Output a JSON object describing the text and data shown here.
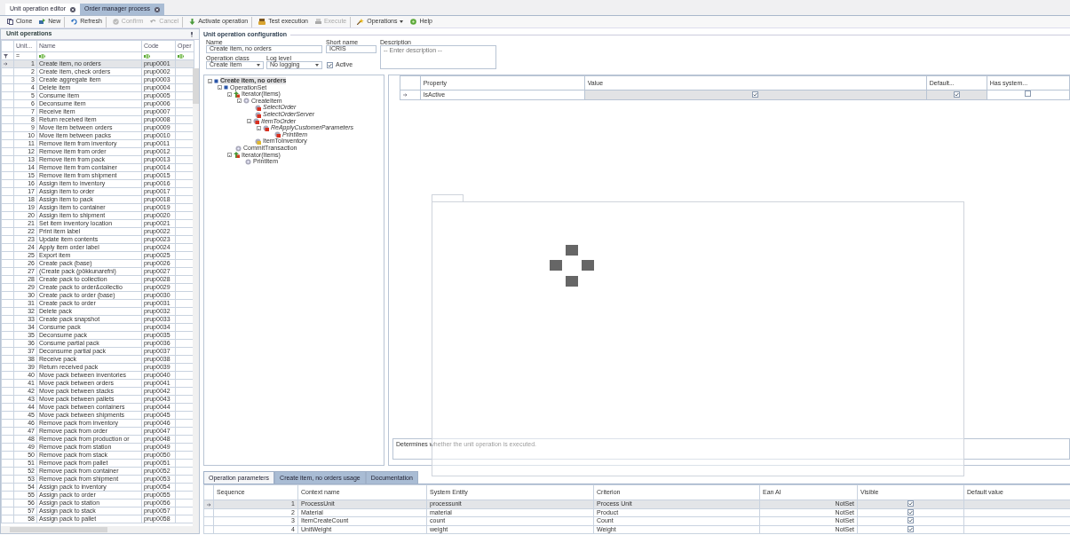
{
  "document_tabs": [
    {
      "label": "Unit operation editor",
      "selected": true
    },
    {
      "label": "Order manager process",
      "selected": false
    }
  ],
  "toolbar": [
    {
      "label": "Clone",
      "disabled": false,
      "group_end": false
    },
    {
      "label": "New",
      "disabled": false,
      "group_end": true
    },
    {
      "label": "Refresh",
      "disabled": false,
      "group_end": true
    },
    {
      "label": "Confirm",
      "disabled": true,
      "group_end": false
    },
    {
      "label": "Cancel",
      "disabled": true,
      "group_end": true
    },
    {
      "label": "Activate operation",
      "disabled": false,
      "group_end": true
    },
    {
      "label": "Test execution",
      "disabled": false,
      "group_end": false
    },
    {
      "label": "Execute",
      "disabled": true,
      "group_end": true
    },
    {
      "label": "Operations",
      "disabled": false,
      "group_end": false,
      "dropdown": true
    },
    {
      "label": "Help",
      "disabled": false,
      "group_end": false
    }
  ],
  "left_panel": {
    "title": "Unit operations",
    "columns": [
      "Unit...",
      "Name",
      "Code",
      "Oper"
    ],
    "filter": "=",
    "rows": [
      {
        "number": "1",
        "name": "Create item, no orders",
        "code": "prup0001",
        "selected": true
      },
      {
        "number": "2",
        "name": "Create item, check orders",
        "code": "prup0002",
        "selected": false
      },
      {
        "number": "3",
        "name": "Create aggregate item",
        "code": "prup0003",
        "selected": false
      },
      {
        "number": "4",
        "name": "Delete item",
        "code": "prup0004",
        "selected": false
      },
      {
        "number": "5",
        "name": "Consume item",
        "code": "prup0005",
        "selected": false
      },
      {
        "number": "6",
        "name": "Deconsume item",
        "code": "prup0006",
        "selected": false
      },
      {
        "number": "7",
        "name": "Receive item",
        "code": "prup0007",
        "selected": false
      },
      {
        "number": "8",
        "name": "Return received item",
        "code": "prup0008",
        "selected": false
      },
      {
        "number": "9",
        "name": "Move item between orders",
        "code": "prup0009",
        "selected": false
      },
      {
        "number": "10",
        "name": "Move item between packs",
        "code": "prup0010",
        "selected": false
      },
      {
        "number": "11",
        "name": "Remove item from inventory",
        "code": "prup0011",
        "selected": false
      },
      {
        "number": "12",
        "name": "Remove item from order",
        "code": "prup0012",
        "selected": false
      },
      {
        "number": "13",
        "name": "Remove item from pack",
        "code": "prup0013",
        "selected": false
      },
      {
        "number": "14",
        "name": "Remove item from container",
        "code": "prup0014",
        "selected": false
      },
      {
        "number": "15",
        "name": "Remove item from shipment",
        "code": "prup0015",
        "selected": false
      },
      {
        "number": "16",
        "name": "Assign item to inventory",
        "code": "prup0016",
        "selected": false
      },
      {
        "number": "17",
        "name": "Assign item to order",
        "code": "prup0017",
        "selected": false
      },
      {
        "number": "18",
        "name": "Assign item to pack",
        "code": "prup0018",
        "selected": false
      },
      {
        "number": "19",
        "name": "Assign item to container",
        "code": "prup0019",
        "selected": false
      },
      {
        "number": "20",
        "name": "Assign item to shipment",
        "code": "prup0020",
        "selected": false
      },
      {
        "number": "21",
        "name": "Set item inventory location",
        "code": "prup0021",
        "selected": false
      },
      {
        "number": "22",
        "name": "Print item label",
        "code": "prup0022",
        "selected": false
      },
      {
        "number": "23",
        "name": "Update item contents",
        "code": "prup0023",
        "selected": false
      },
      {
        "number": "24",
        "name": "Apply item order label",
        "code": "prup0024",
        "selected": false
      },
      {
        "number": "25",
        "name": "Export item",
        "code": "prup0025",
        "selected": false
      },
      {
        "number": "26",
        "name": "Create pack (base)",
        "code": "prup0026",
        "selected": false
      },
      {
        "number": "27",
        "name": "(Create pack (pökkunarefni)",
        "code": "prup0027",
        "selected": false
      },
      {
        "number": "28",
        "name": "Create pack to collection",
        "code": "prup0028",
        "selected": false
      },
      {
        "number": "29",
        "name": "Create pack to order&collectio",
        "code": "prup0029",
        "selected": false
      },
      {
        "number": "30",
        "name": "Create pack to order (base)",
        "code": "prup0030",
        "selected": false
      },
      {
        "number": "31",
        "name": "Create pack to order",
        "code": "prup0031",
        "selected": false
      },
      {
        "number": "32",
        "name": "Delete pack",
        "code": "prup0032",
        "selected": false
      },
      {
        "number": "33",
        "name": "Create pack snapshot",
        "code": "prup0033",
        "selected": false
      },
      {
        "number": "34",
        "name": "Consume pack",
        "code": "prup0034",
        "selected": false
      },
      {
        "number": "35",
        "name": "Deconsume pack",
        "code": "prup0035",
        "selected": false
      },
      {
        "number": "36",
        "name": "Consume partial pack",
        "code": "prup0036",
        "selected": false
      },
      {
        "number": "37",
        "name": "Deconsume partial pack",
        "code": "prup0037",
        "selected": false
      },
      {
        "number": "38",
        "name": "Receive pack",
        "code": "prup0038",
        "selected": false
      },
      {
        "number": "39",
        "name": "Return received pack",
        "code": "prup0039",
        "selected": false
      },
      {
        "number": "40",
        "name": "Move pack between inventories",
        "code": "prup0040",
        "selected": false
      },
      {
        "number": "41",
        "name": "Move pack between orders",
        "code": "prup0041",
        "selected": false
      },
      {
        "number": "42",
        "name": "Move pack between stacks",
        "code": "prup0042",
        "selected": false
      },
      {
        "number": "43",
        "name": "Move pack between pallets",
        "code": "prup0043",
        "selected": false
      },
      {
        "number": "44",
        "name": "Move pack between containers",
        "code": "prup0044",
        "selected": false
      },
      {
        "number": "45",
        "name": "Move pack between shipments",
        "code": "prup0045",
        "selected": false
      },
      {
        "number": "46",
        "name": "Remove pack from inventory",
        "code": "prup0046",
        "selected": false
      },
      {
        "number": "47",
        "name": "Remove pack from order",
        "code": "prup0047",
        "selected": false
      },
      {
        "number": "48",
        "name": "Remove pack from production or",
        "code": "prup0048",
        "selected": false
      },
      {
        "number": "49",
        "name": "Remove pack from station",
        "code": "prup0049",
        "selected": false
      },
      {
        "number": "50",
        "name": "Remove pack from stack",
        "code": "prup0050",
        "selected": false
      },
      {
        "number": "51",
        "name": "Remove pack from pallet",
        "code": "prup0051",
        "selected": false
      },
      {
        "number": "52",
        "name": "Remove pack from container",
        "code": "prup0052",
        "selected": false
      },
      {
        "number": "53",
        "name": "Remove pack from shipment",
        "code": "prup0053",
        "selected": false
      },
      {
        "number": "54",
        "name": "Assign pack to inventory",
        "code": "prup0054",
        "selected": false
      },
      {
        "number": "55",
        "name": "Assign pack to order",
        "code": "prup0055",
        "selected": false
      },
      {
        "number": "56",
        "name": "Assign pack to station",
        "code": "prup0056",
        "selected": false
      },
      {
        "number": "57",
        "name": "Assign pack to stack",
        "code": "prup0057",
        "selected": false
      },
      {
        "number": "58",
        "name": "Assign pack to pallet",
        "code": "prup0058",
        "selected": false
      }
    ]
  },
  "config": {
    "title": "Unit operation configuration",
    "name": {
      "label": "Name",
      "value": "Create item, no orders"
    },
    "short_name": {
      "label": "Short name",
      "value": "ICRIS"
    },
    "description": {
      "label": "Description",
      "placeholder": "-- Enter description --"
    },
    "operation_class": {
      "label": "Operation class",
      "value": "Create item"
    },
    "log_level": {
      "label": "Log level",
      "value": "No logging"
    },
    "active": {
      "label": "Active",
      "checked": true
    }
  },
  "tree": [
    {
      "label": "Create item, no orders",
      "kind": "root",
      "selected": true,
      "disabled": false,
      "children": [
        {
          "label": "OperationSet",
          "kind": "set",
          "selected": false,
          "disabled": false,
          "children": [
            {
              "label": "Iterator(Items)",
              "kind": "iterator",
              "selected": false,
              "disabled": false,
              "children": [
                {
                  "label": "CreateItem",
                  "kind": "step",
                  "selected": false,
                  "disabled": false,
                  "children": [
                    {
                      "label": "SelectOrder",
                      "kind": "step",
                      "selected": false,
                      "disabled": true
                    },
                    {
                      "label": "SelectOrderServer",
                      "kind": "step",
                      "selected": false,
                      "disabled": true
                    },
                    {
                      "label": "ItemToOrder",
                      "kind": "step",
                      "selected": false,
                      "disabled": true,
                      "children": [
                        {
                          "label": "ReApplyCustomerParameters",
                          "kind": "step",
                          "selected": false,
                          "disabled": true,
                          "children": [
                            {
                              "label": "PrintItem",
                              "kind": "step",
                              "selected": false,
                              "disabled": true
                            }
                          ]
                        }
                      ]
                    },
                    {
                      "label": "ItemToInventory",
                      "kind": "output",
                      "selected": false,
                      "disabled": false
                    }
                  ]
                }
              ]
            },
            {
              "label": "CommitTransaction",
              "kind": "step",
              "selected": false,
              "disabled": false
            },
            {
              "label": "Iterator(Items)",
              "kind": "iterator",
              "selected": false,
              "disabled": false,
              "children": [
                {
                  "label": "PrintItem",
                  "kind": "step",
                  "selected": false,
                  "disabled": false
                }
              ]
            }
          ]
        }
      ]
    }
  ],
  "property_grid": {
    "columns": [
      "Property",
      "Value",
      "Default...",
      "Has system..."
    ],
    "rows": [
      {
        "property": "IsActive",
        "value": true,
        "default": true,
        "has_system": false,
        "selected": true
      }
    ],
    "description": "Determines whether the unit operation is executed.",
    "loading": true
  },
  "bottom_tabs": [
    {
      "label": "Operation parameters",
      "selected": true
    },
    {
      "label": "Create item, no orders usage",
      "selected": false
    },
    {
      "label": "Documentation",
      "selected": false
    }
  ],
  "parameters": {
    "columns": [
      "Sequence",
      "Context name",
      "System Entity",
      "Criterion",
      "Ean AI",
      "Visible",
      "Default value"
    ],
    "rows": [
      {
        "sequence": "1",
        "context_name": "ProcessUnit",
        "system_entity": "processunit",
        "criterion": "Process Unit",
        "ean_ai": "NotSet",
        "visible": true,
        "selected": true
      },
      {
        "sequence": "2",
        "context_name": "Material",
        "system_entity": "material",
        "criterion": "Product",
        "ean_ai": "NotSet",
        "visible": true,
        "selected": false
      },
      {
        "sequence": "3",
        "context_name": "ItemCreateCount",
        "system_entity": "count",
        "criterion": "Count",
        "ean_ai": "NotSet",
        "visible": true,
        "selected": false
      },
      {
        "sequence": "4",
        "context_name": "UnitWeight",
        "system_entity": "weight",
        "criterion": "Weight",
        "ean_ai": "NotSet",
        "visible": true,
        "selected": false
      }
    ]
  }
}
